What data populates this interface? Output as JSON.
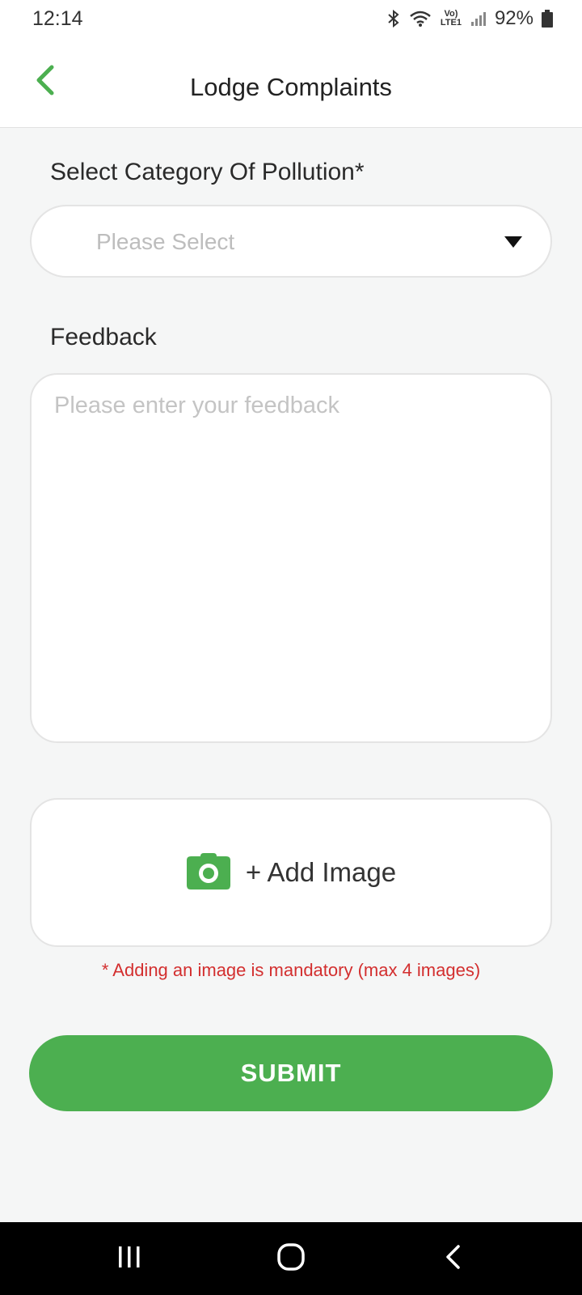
{
  "status_bar": {
    "time": "12:14",
    "network_label": "Vo) LTE1",
    "battery": "92%",
    "icons": [
      "bluetooth-icon",
      "wifi-icon",
      "signal-icon",
      "battery-icon"
    ]
  },
  "app_bar": {
    "title": "Lodge Complaints",
    "back_icon": "chevron-left-icon"
  },
  "form": {
    "category_label": "Select Category Of Pollution*",
    "category_placeholder": "Please Select",
    "feedback_label": "Feedback",
    "feedback_placeholder": "Please enter your feedback",
    "add_image_label": "+ Add Image",
    "mandatory_note": "* Adding an image is mandatory (max 4 images)",
    "submit_label": "SUBMIT"
  },
  "colors": {
    "accent": "#4caf50",
    "error": "#d32f2f",
    "background": "#f5f6f6"
  },
  "nav_bar": {
    "icons": [
      "recent-apps-icon",
      "home-icon",
      "back-icon"
    ]
  }
}
